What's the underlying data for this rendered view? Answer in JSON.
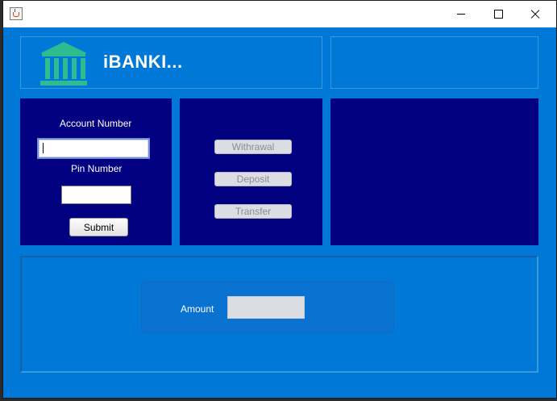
{
  "window": {
    "title": ""
  },
  "header": {
    "brand": "iBANKI..."
  },
  "login": {
    "account_label": "Account Number",
    "account_value": "",
    "pin_label": "Pin Number",
    "pin_value": "",
    "submit_label": "Submit"
  },
  "actions": {
    "withdrawal_label": "Withrawal",
    "deposit_label": "Deposit",
    "transfer_label": "Transfer"
  },
  "amount": {
    "label": "Amount",
    "value": ""
  },
  "colors": {
    "window_bg": "#0078d7",
    "panel_navy": "#000080",
    "bank_icon": "#2dbb8f",
    "text": "#ffffff"
  },
  "icons": {
    "app": "java-cup-icon",
    "bank": "bank-building-icon"
  }
}
